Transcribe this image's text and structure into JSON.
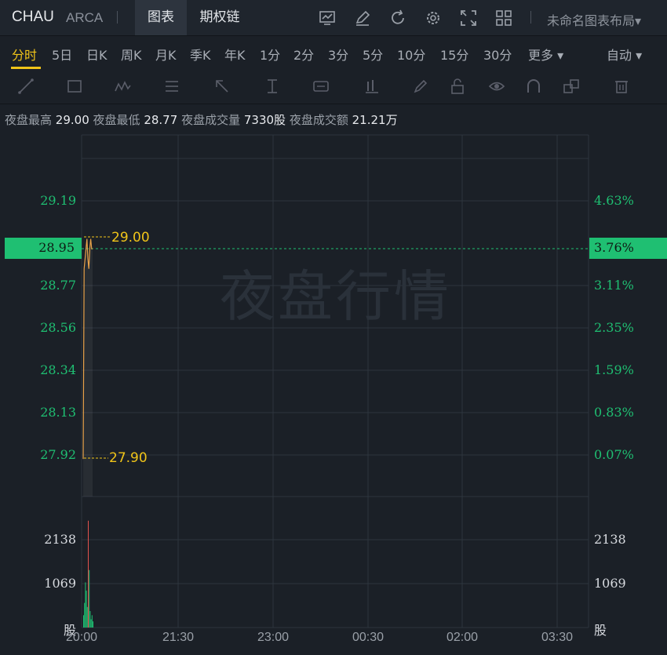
{
  "header": {
    "symbol": "CHAU",
    "exchange": "ARCA",
    "tabs": [
      "图表",
      "期权链"
    ],
    "layout_name": "未命名图表布局▾"
  },
  "periods": {
    "items": [
      "分时",
      "5日",
      "日K",
      "周K",
      "月K",
      "季K",
      "年K",
      "1分",
      "2分",
      "3分",
      "5分",
      "10分",
      "15分",
      "30分",
      "更多 ▾"
    ],
    "active": "分时",
    "mode": "自动 ▾"
  },
  "info": {
    "high_label": "夜盘最高",
    "high_value": "29.00",
    "low_label": "夜盘最低",
    "low_value": "28.77",
    "volume_label": "夜盘成交量",
    "volume_value": "7330股",
    "amount_label": "夜盘成交额",
    "amount_value": "21.21万"
  },
  "chart": {
    "watermark": "夜盘行情",
    "price_ticks": [
      "29.19",
      "28.77",
      "28.56",
      "28.34",
      "28.13",
      "27.92"
    ],
    "pct_ticks": [
      "4.63%",
      "3.11%",
      "2.35%",
      "1.59%",
      "0.83%",
      "0.07%"
    ],
    "current_price": "28.95",
    "current_pct": "3.76%",
    "high_marker": "29.00",
    "low_marker": "27.90",
    "volume_ticks": [
      "2138",
      "1069",
      "股"
    ],
    "time_ticks": [
      "20:00",
      "21:30",
      "23:00",
      "00:30",
      "02:00",
      "03:30"
    ],
    "colors": {
      "up": "#1fbf72",
      "marker": "#f0c419",
      "down": "#e2524c",
      "line": "#e8a24a"
    }
  },
  "chart_data": {
    "type": "line",
    "x": [
      "20:00",
      "20:01",
      "20:02",
      "20:03",
      "20:04",
      "20:05",
      "20:06",
      "20:07",
      "20:08",
      "20:09",
      "20:10"
    ],
    "series": [
      {
        "values": [
          27.9,
          28.85,
          28.9,
          28.95,
          29.0,
          28.9,
          28.85,
          28.95,
          29.0,
          28.95,
          28.95
        ]
      }
    ],
    "volume": [
      300,
      600,
      1100,
      900,
      500,
      2600,
      1400,
      400,
      200,
      300,
      150
    ],
    "ylim": [
      27.9,
      29.3
    ],
    "volume_ticks": [
      1069,
      2138
    ]
  }
}
